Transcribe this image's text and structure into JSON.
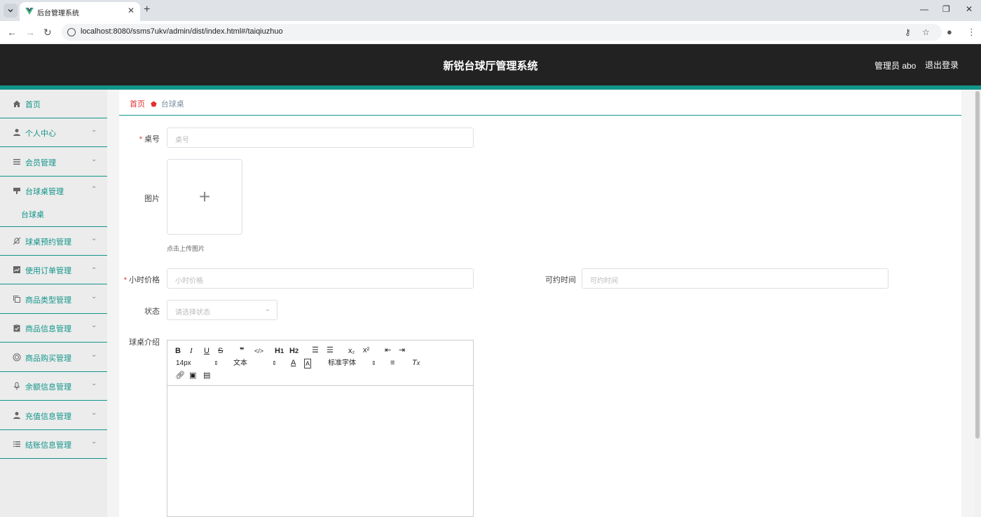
{
  "browser": {
    "tab_title": "后台管理系统",
    "url": "localhost:8080/ssms7ukv/admin/dist/index.html#/taiqiuzhuo"
  },
  "header": {
    "title": "新锐台球厅管理系统",
    "user": "管理员 abo",
    "logout": "退出登录"
  },
  "sidebar": {
    "items": [
      {
        "label": "首页",
        "icon": "home-icon"
      },
      {
        "label": "个人中心",
        "icon": "user-icon"
      },
      {
        "label": "会员管理",
        "icon": "list-icon"
      },
      {
        "label": "台球桌管理",
        "icon": "table-icon",
        "expanded": true
      },
      {
        "label": "球桌预约管理",
        "icon": "bell-off-icon"
      },
      {
        "label": "使用订单管理",
        "icon": "chart-icon"
      },
      {
        "label": "商品类型管理",
        "icon": "copy-icon"
      },
      {
        "label": "商品信息管理",
        "icon": "clipboard-icon"
      },
      {
        "label": "商品购买管理",
        "icon": "globe-icon"
      },
      {
        "label": "余额信息管理",
        "icon": "mic-icon"
      },
      {
        "label": "充值信息管理",
        "icon": "user-icon"
      },
      {
        "label": "结账信息管理",
        "icon": "list-icon"
      }
    ],
    "sub_item": "台球桌"
  },
  "breadcrumb": {
    "home": "首页",
    "current": "台球桌"
  },
  "form": {
    "zhuohao_label": "桌号",
    "zhuohao_placeholder": "桌号",
    "tupian_label": "图片",
    "upload_tip": "点击上传图片",
    "price_label": "小时价格",
    "price_placeholder": "小时价格",
    "time_label": "可约时间",
    "time_placeholder": "可约时间",
    "status_label": "状态",
    "status_placeholder": "请选择状态",
    "intro_label": "球桌介绍"
  },
  "editor": {
    "font_size": "14px",
    "header_select": "文本",
    "font_family": "标准字体"
  },
  "colors": {
    "accent": "#12958a",
    "header_bg": "#222222",
    "required": "#e0312f"
  }
}
